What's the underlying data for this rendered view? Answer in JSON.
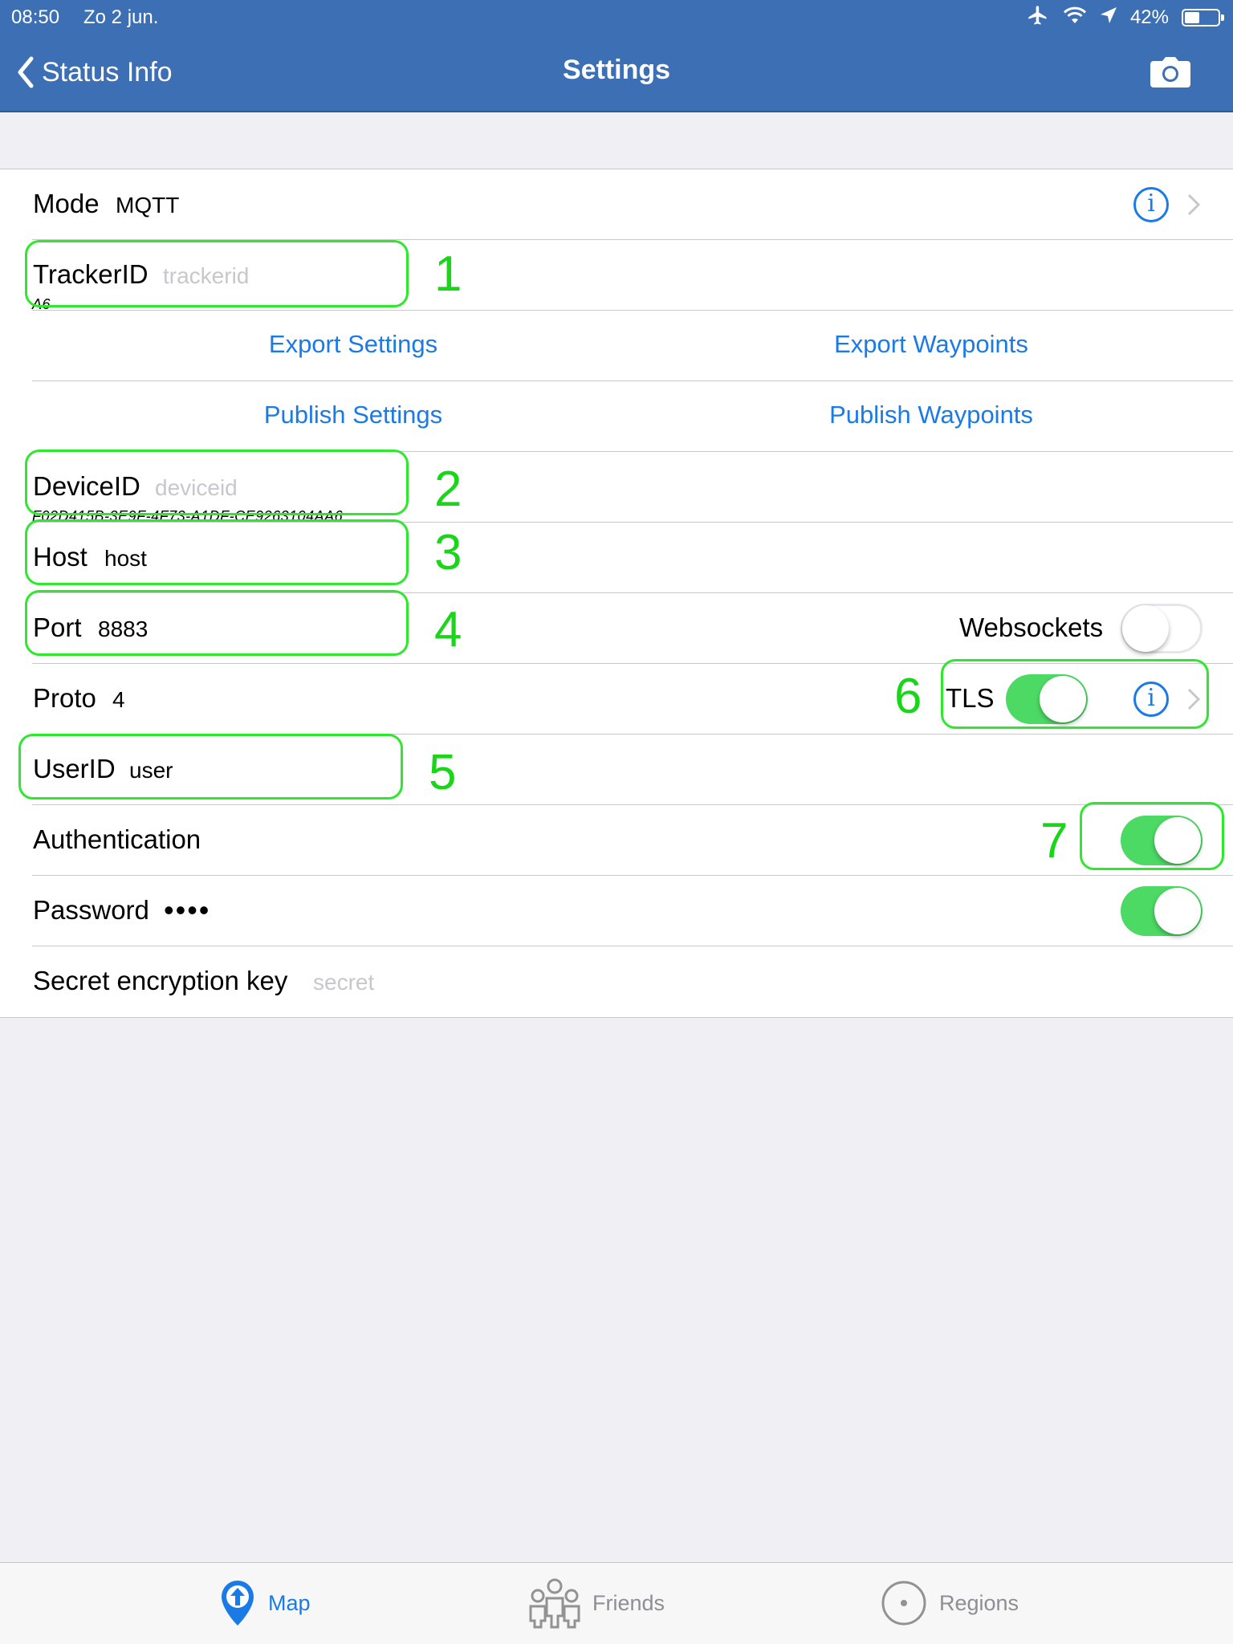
{
  "status_bar": {
    "time": "08:50",
    "date": "Zo 2 jun.",
    "battery": "42%",
    "icons": [
      "airplane-icon",
      "wifi-icon",
      "location-arrow-icon",
      "battery-icon"
    ]
  },
  "nav": {
    "back_label": "Status Info",
    "title": "Settings",
    "right_icon": "camera-icon"
  },
  "settings": {
    "mode": {
      "label": "Mode",
      "value": "MQTT"
    },
    "tracker": {
      "label": "TrackerID",
      "placeholder": "trackerid",
      "sub": "A6"
    },
    "export_settings": "Export Settings",
    "export_waypoints": "Export Waypoints",
    "publish_settings": "Publish Settings",
    "publish_waypoints": "Publish Waypoints",
    "device": {
      "label": "DeviceID",
      "placeholder": "deviceid",
      "sub": "F02D415B-3E9F-4F73-A1DF-CE9263104AA6"
    },
    "host": {
      "label": "Host",
      "value": "host"
    },
    "port": {
      "label": "Port",
      "value": "8883"
    },
    "websockets": {
      "label": "Websockets",
      "on": false
    },
    "proto": {
      "label": "Proto",
      "value": "4"
    },
    "tls": {
      "label": "TLS",
      "on": true
    },
    "user": {
      "label": "UserID",
      "value": "user"
    },
    "authentication": {
      "label": "Authentication",
      "on": true
    },
    "password": {
      "label": "Password",
      "value": "••••",
      "on": true
    },
    "secret": {
      "label": "Secret encryption key",
      "placeholder": "secret"
    }
  },
  "annotations": [
    "1",
    "2",
    "3",
    "4",
    "5",
    "6",
    "7"
  ],
  "tabs": [
    {
      "label": "Map",
      "icon": "map-pin-icon",
      "active": true
    },
    {
      "label": "Friends",
      "icon": "friends-icon",
      "active": false
    },
    {
      "label": "Regions",
      "icon": "regions-icon",
      "active": false
    }
  ],
  "colors": {
    "nav_bar": "#3d6fb4",
    "link": "#1a7ae6",
    "toggle_on": "#4cd964",
    "annotation": "#2ee82e",
    "background": "#efeff4"
  }
}
